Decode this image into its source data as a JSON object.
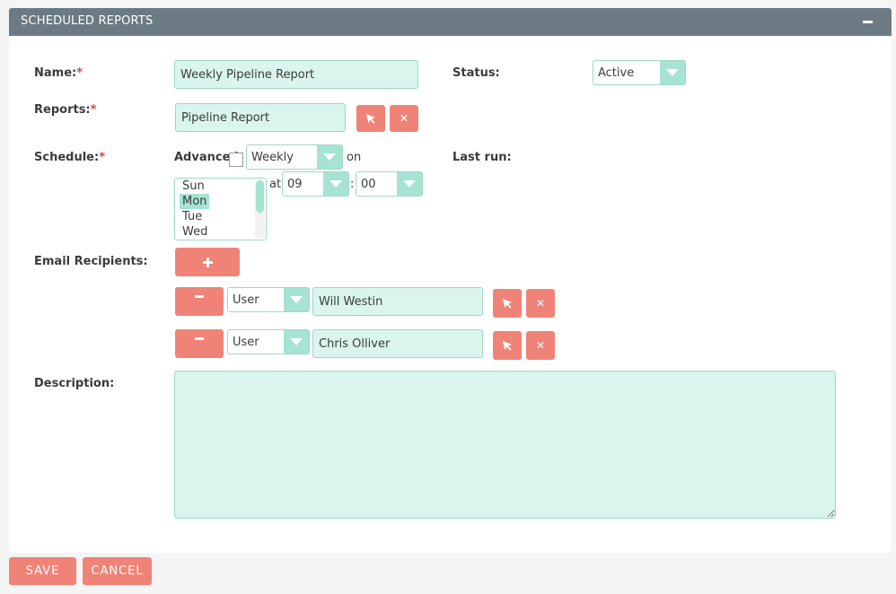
{
  "panel": {
    "title": "SCHEDULED REPORTS"
  },
  "form": {
    "name": {
      "label": "Name:",
      "required_mark": "*",
      "value": "Weekly Pipeline Report"
    },
    "status": {
      "label": "Status:",
      "value": "Active"
    },
    "reports": {
      "label": "Reports:",
      "required_mark": "*",
      "value": "Pipeline Report"
    },
    "schedule": {
      "label": "Schedule:",
      "required_mark": "*",
      "advanced_label": "Advanced",
      "frequency": "Weekly",
      "on_text": "on",
      "at_text": "at",
      "colon": ":",
      "hour": "09",
      "minute": "00",
      "days": [
        "Sun",
        "Mon",
        "Tue",
        "Wed"
      ],
      "selected_day": "Mon"
    },
    "last_run": {
      "label": "Last run:"
    },
    "email_recipients": {
      "label": "Email Recipients:",
      "rows": [
        {
          "type": "User",
          "name": "Will Westin"
        },
        {
          "type": "User",
          "name": "Chris Olliver"
        }
      ]
    },
    "description": {
      "label": "Description:",
      "value": ""
    }
  },
  "footer": {
    "save_label": "SAVE",
    "cancel_label": "CANCEL"
  },
  "colors": {
    "header": "#6b7a83",
    "accent_button": "#f08377",
    "field_fill": "#d9f5ee",
    "field_border": "#9ed8c6",
    "select_arrow": "#a5e3d3",
    "required": "#e5403b"
  }
}
